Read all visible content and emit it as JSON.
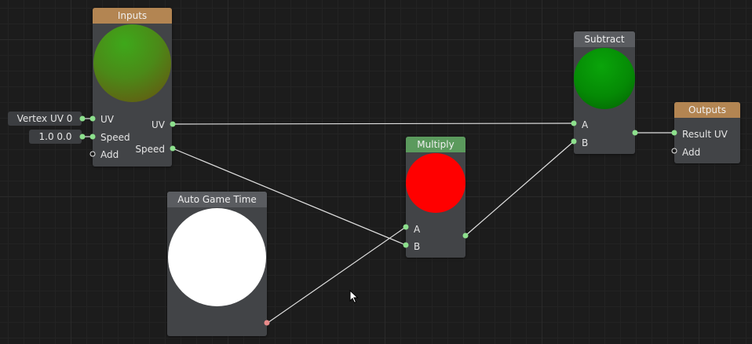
{
  "colors": {
    "header_orange": "#b38552",
    "header_grey": "#5a5c60",
    "header_green": "#5b9a5d",
    "pin_green": "#8de08d",
    "pin_red": "#e88a8a",
    "wire": "#e0e0e0"
  },
  "nodes": {
    "inputs": {
      "title": "Inputs",
      "pins_in": [
        "UV",
        "Speed",
        "Add"
      ],
      "pins_out": [
        "UV",
        "Speed"
      ]
    },
    "constants": {
      "uv_value": "Vertex UV 0",
      "speed_value": "1.0 0.0"
    },
    "auto_game_time": {
      "title": "Auto Game Time"
    },
    "multiply": {
      "title": "Multiply",
      "pins_in": [
        "A",
        "B"
      ]
    },
    "subtract": {
      "title": "Subtract",
      "pins_in": [
        "A",
        "B"
      ]
    },
    "outputs": {
      "title": "Outputs",
      "pins_in": [
        "Result UV",
        "Add"
      ]
    }
  },
  "icons": {
    "cursor": "arrow-cursor-icon"
  }
}
